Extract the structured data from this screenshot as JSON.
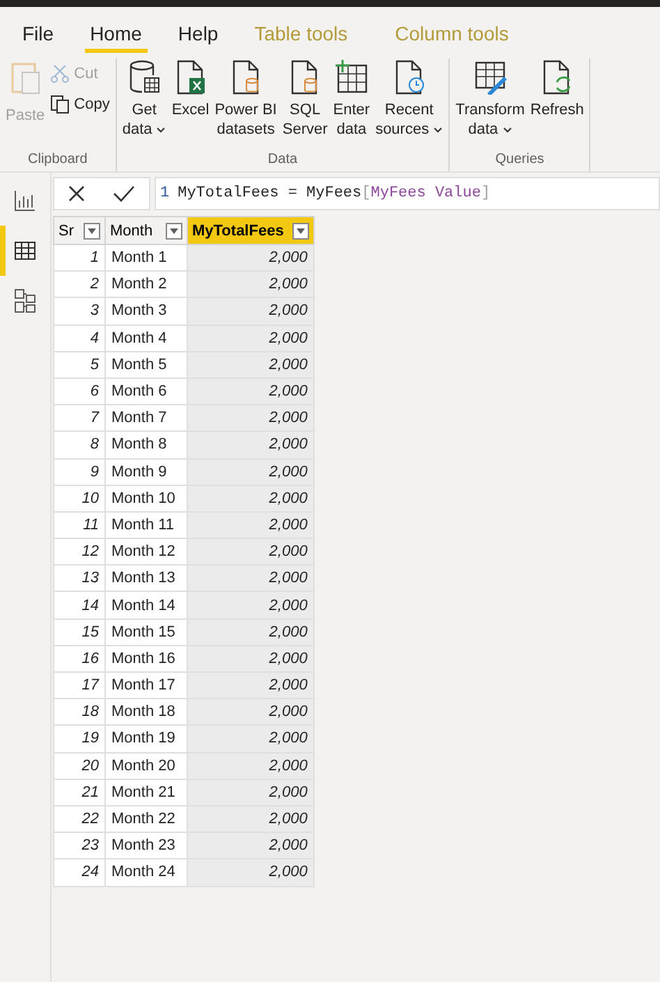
{
  "tabs": [
    {
      "label": "File",
      "selected": false,
      "contextual": false
    },
    {
      "label": "Home",
      "selected": true,
      "contextual": false
    },
    {
      "label": "Help",
      "selected": false,
      "contextual": false
    },
    {
      "label": "Table tools",
      "selected": false,
      "contextual": true
    },
    {
      "label": "Column tools",
      "selected": false,
      "contextual": true
    }
  ],
  "ribbon_groups": [
    {
      "title": "Clipboard",
      "kind": "clipboard",
      "buttons": [
        {
          "lines": [
            "Paste"
          ],
          "disabled": true
        },
        {
          "lines": [
            "Cut"
          ],
          "disabled": true
        },
        {
          "lines": [
            "Copy"
          ],
          "disabled": false
        }
      ]
    },
    {
      "title": "Data",
      "kind": "large",
      "buttons": [
        {
          "lines": [
            "Get",
            "data"
          ],
          "dropdown": true,
          "disabled": false
        },
        {
          "lines": [
            "Excel"
          ],
          "disabled": false
        },
        {
          "lines": [
            "Power BI",
            "datasets"
          ],
          "disabled": false
        },
        {
          "lines": [
            "SQL",
            "Server"
          ],
          "disabled": false
        },
        {
          "lines": [
            "Enter",
            "data"
          ],
          "disabled": false
        },
        {
          "lines": [
            "Recent",
            "sources"
          ],
          "dropdown": true,
          "disabled": false
        }
      ]
    },
    {
      "title": "Queries",
      "kind": "large",
      "buttons": [
        {
          "lines": [
            "Transform",
            "data"
          ],
          "dropdown": true,
          "disabled": false
        },
        {
          "lines": [
            "Refresh"
          ],
          "disabled": false
        }
      ]
    }
  ],
  "sidebar": [
    {
      "selected": false
    },
    {
      "selected": true
    },
    {
      "selected": false
    }
  ],
  "formula_bar": {
    "line_number": "1",
    "segments": [
      {
        "kind": "plain",
        "text": "MyTotalFees = MyFees"
      },
      {
        "kind": "bracket",
        "text": "["
      },
      {
        "kind": "column",
        "text": "MyFees Value"
      },
      {
        "kind": "bracket",
        "text": "]"
      }
    ]
  },
  "table": {
    "columns": [
      {
        "label": "Sr",
        "selected": false
      },
      {
        "label": "Month",
        "selected": false
      },
      {
        "label": "MyTotalFees",
        "selected": true
      }
    ],
    "rows": [
      [
        "1",
        "Month 1",
        "2,000"
      ],
      [
        "2",
        "Month 2",
        "2,000"
      ],
      [
        "3",
        "Month 3",
        "2,000"
      ],
      [
        "4",
        "Month 4",
        "2,000"
      ],
      [
        "5",
        "Month 5",
        "2,000"
      ],
      [
        "6",
        "Month 6",
        "2,000"
      ],
      [
        "7",
        "Month 7",
        "2,000"
      ],
      [
        "8",
        "Month 8",
        "2,000"
      ],
      [
        "9",
        "Month 9",
        "2,000"
      ],
      [
        "10",
        "Month 10",
        "2,000"
      ],
      [
        "11",
        "Month 11",
        "2,000"
      ],
      [
        "12",
        "Month 12",
        "2,000"
      ],
      [
        "13",
        "Month 13",
        "2,000"
      ],
      [
        "14",
        "Month 14",
        "2,000"
      ],
      [
        "15",
        "Month 15",
        "2,000"
      ],
      [
        "16",
        "Month 16",
        "2,000"
      ],
      [
        "17",
        "Month 17",
        "2,000"
      ],
      [
        "18",
        "Month 18",
        "2,000"
      ],
      [
        "19",
        "Month 19",
        "2,000"
      ],
      [
        "20",
        "Month 20",
        "2,000"
      ],
      [
        "21",
        "Month 21",
        "2,000"
      ],
      [
        "22",
        "Month 22",
        "2,000"
      ],
      [
        "23",
        "Month 23",
        "2,000"
      ],
      [
        "24",
        "Month 24",
        "2,000"
      ]
    ]
  }
}
